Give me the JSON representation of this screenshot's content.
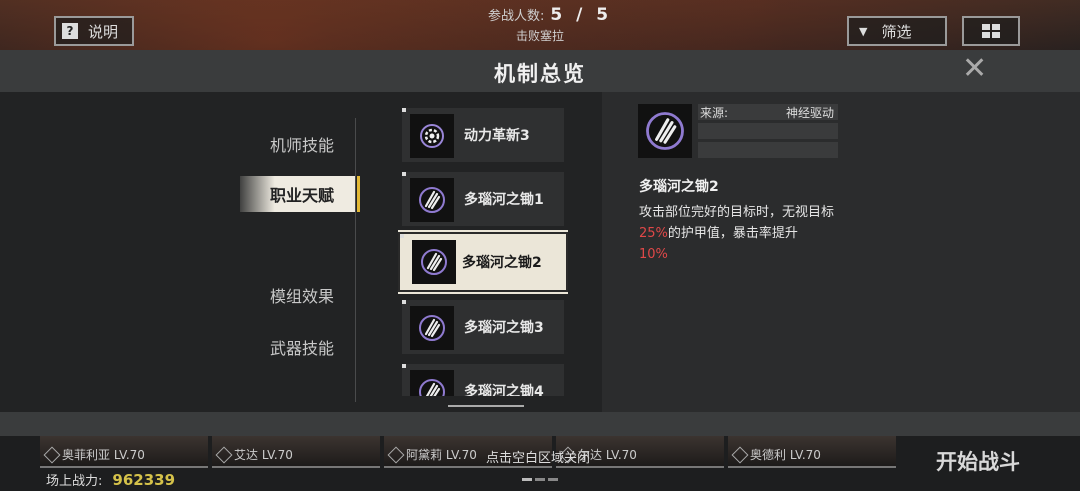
{
  "background": {
    "help_label": "说明",
    "players_label": "参战人数:",
    "players_value": "5 / 5",
    "defeat_label": "击败塞拉",
    "filter_label": "筛选",
    "characters": [
      {
        "name": "奥菲利亚 LV.70"
      },
      {
        "name": "艾达 LV.70"
      },
      {
        "name": "阿黛莉 LV.70"
      },
      {
        "name": "尔达 LV.70"
      },
      {
        "name": "奥德利 LV.70"
      }
    ],
    "power_label": "场上战力:",
    "power_value": "962339",
    "start_label": "开始战斗",
    "close_hint": "点击空白区域关闭"
  },
  "modal": {
    "title": "机制总览",
    "close_icon": "close-icon",
    "tabs": [
      {
        "label": "机师技能",
        "active": false
      },
      {
        "label": "职业天赋",
        "active": true
      },
      {
        "label": "模组效果",
        "active": false
      },
      {
        "label": "武器技能",
        "active": false
      }
    ],
    "skills": [
      {
        "label": "动力革新3",
        "icon": "gear-icon",
        "selected": false
      },
      {
        "label": "多瑙河之锄1",
        "icon": "claw-icon",
        "selected": false
      },
      {
        "label": "多瑙河之锄2",
        "icon": "claw-icon",
        "selected": true
      },
      {
        "label": "多瑙河之锄3",
        "icon": "claw-icon",
        "selected": false
      },
      {
        "label": "多瑙河之锄4",
        "icon": "claw-icon",
        "selected": false
      }
    ],
    "detail": {
      "icon": "claw-icon",
      "source_label": "来源:",
      "source_value": "神经驱动",
      "name": "多瑙河之锄2",
      "desc_part1": "攻击部位完好的目标时，无视目标",
      "desc_hl1": "25%",
      "desc_part2": "的护甲值，暴击率提升",
      "desc_hl2": "10%"
    }
  },
  "colors": {
    "accent": "#e3b936",
    "highlight": "#e04848",
    "selected_bg": "#ebe6d8"
  }
}
